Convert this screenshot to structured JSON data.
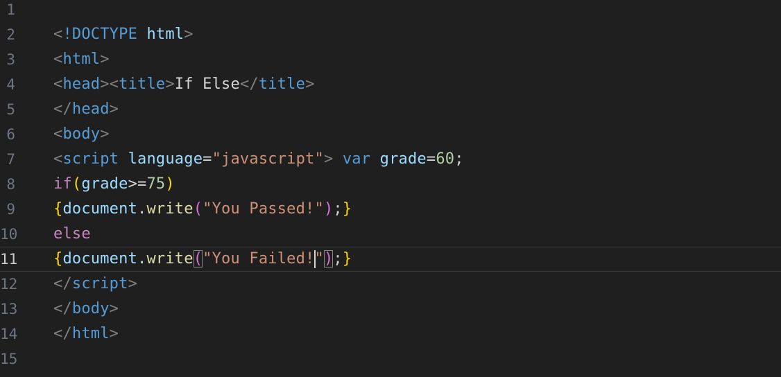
{
  "editor": {
    "colors": {
      "background": "#1f1f1f",
      "gutter": "#6e7681",
      "gutter_active": "#cccccc",
      "punct": "#808080",
      "tag": "#569cd6",
      "attr": "#9cdcfe",
      "string": "#ce9178",
      "keyword": "#c586c0",
      "number": "#b5cea8",
      "func": "#dcdcaa",
      "text": "#d4d4d4",
      "bracket_gold": "#ffd700",
      "bracket_pink": "#da70d6"
    },
    "lines": [
      {
        "num": "1",
        "tokens": []
      },
      {
        "num": "2",
        "tokens": [
          {
            "t": "<",
            "c": "punct"
          },
          {
            "t": "!DOCTYPE",
            "c": "tag"
          },
          {
            "t": " ",
            "c": "text"
          },
          {
            "t": "html",
            "c": "attr"
          },
          {
            "t": ">",
            "c": "punct"
          }
        ]
      },
      {
        "num": "3",
        "tokens": [
          {
            "t": "<",
            "c": "punct"
          },
          {
            "t": "html",
            "c": "tag"
          },
          {
            "t": ">",
            "c": "punct"
          }
        ]
      },
      {
        "num": "4",
        "tokens": [
          {
            "t": "<",
            "c": "punct"
          },
          {
            "t": "head",
            "c": "tag"
          },
          {
            "t": ">",
            "c": "punct"
          },
          {
            "t": "<",
            "c": "punct"
          },
          {
            "t": "title",
            "c": "tag"
          },
          {
            "t": ">",
            "c": "punct"
          },
          {
            "t": "If Else",
            "c": "text"
          },
          {
            "t": "</",
            "c": "punct"
          },
          {
            "t": "title",
            "c": "tag"
          },
          {
            "t": ">",
            "c": "punct"
          }
        ]
      },
      {
        "num": "5",
        "tokens": [
          {
            "t": "</",
            "c": "punct"
          },
          {
            "t": "head",
            "c": "tag"
          },
          {
            "t": ">",
            "c": "punct"
          }
        ]
      },
      {
        "num": "6",
        "tokens": [
          {
            "t": "<",
            "c": "punct"
          },
          {
            "t": "body",
            "c": "tag"
          },
          {
            "t": ">",
            "c": "punct"
          }
        ]
      },
      {
        "num": "7",
        "tokens": [
          {
            "t": "<",
            "c": "punct"
          },
          {
            "t": "script",
            "c": "tag"
          },
          {
            "t": " ",
            "c": "text"
          },
          {
            "t": "language",
            "c": "attr"
          },
          {
            "t": "=",
            "c": "text"
          },
          {
            "t": "\"javascript\"",
            "c": "string"
          },
          {
            "t": ">",
            "c": "punct"
          },
          {
            "t": " ",
            "c": "text"
          },
          {
            "t": "var",
            "c": "tag"
          },
          {
            "t": " ",
            "c": "text"
          },
          {
            "t": "grade",
            "c": "attr"
          },
          {
            "t": "=",
            "c": "text"
          },
          {
            "t": "60",
            "c": "number"
          },
          {
            "t": ";",
            "c": "text"
          }
        ]
      },
      {
        "num": "8",
        "tokens": [
          {
            "t": "if",
            "c": "keyword"
          },
          {
            "t": "(",
            "c": "bracket_gold"
          },
          {
            "t": "grade",
            "c": "attr"
          },
          {
            "t": ">=",
            "c": "text"
          },
          {
            "t": "75",
            "c": "number"
          },
          {
            "t": ")",
            "c": "bracket_gold"
          }
        ]
      },
      {
        "num": "9",
        "tokens": [
          {
            "t": "{",
            "c": "bracket_gold"
          },
          {
            "t": "document",
            "c": "attr"
          },
          {
            "t": ".",
            "c": "text"
          },
          {
            "t": "write",
            "c": "func"
          },
          {
            "t": "(",
            "c": "bracket_pink"
          },
          {
            "t": "\"You Passed!\"",
            "c": "string"
          },
          {
            "t": ")",
            "c": "bracket_pink"
          },
          {
            "t": ";",
            "c": "text"
          },
          {
            "t": "}",
            "c": "bracket_gold"
          }
        ]
      },
      {
        "num": "10",
        "tokens": [
          {
            "t": "else",
            "c": "keyword"
          }
        ]
      },
      {
        "num": "11",
        "current": true,
        "tokens": [
          {
            "t": "{",
            "c": "bracket_gold"
          },
          {
            "t": "document",
            "c": "attr"
          },
          {
            "t": ".",
            "c": "text"
          },
          {
            "t": "write",
            "c": "func"
          },
          {
            "t": "(",
            "c": "bracket_pink",
            "box": true
          },
          {
            "t": "\"You Failed!",
            "c": "string"
          },
          {
            "cursor": true
          },
          {
            "t": "\"",
            "c": "string"
          },
          {
            "t": ")",
            "c": "bracket_pink",
            "box": true
          },
          {
            "t": ";",
            "c": "text"
          },
          {
            "t": "}",
            "c": "bracket_gold"
          }
        ]
      },
      {
        "num": "12",
        "tokens": [
          {
            "t": "</",
            "c": "punct"
          },
          {
            "t": "script",
            "c": "tag"
          },
          {
            "t": ">",
            "c": "punct"
          }
        ]
      },
      {
        "num": "13",
        "tokens": [
          {
            "t": "</",
            "c": "punct"
          },
          {
            "t": "body",
            "c": "tag"
          },
          {
            "t": ">",
            "c": "punct"
          }
        ]
      },
      {
        "num": "14",
        "tokens": [
          {
            "t": "</",
            "c": "punct"
          },
          {
            "t": "html",
            "c": "tag"
          },
          {
            "t": ">",
            "c": "punct"
          }
        ]
      },
      {
        "num": "15",
        "tokens": []
      }
    ]
  }
}
